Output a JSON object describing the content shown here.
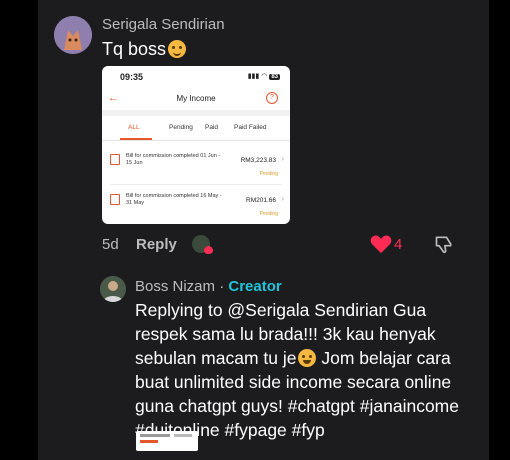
{
  "comment": {
    "username": "Serigala Sendirian",
    "text": "Tq boss",
    "emoji": "smiling-face-with-hearts-icon",
    "age": "5d",
    "reply_label": "Reply",
    "likes": "4"
  },
  "screenshot": {
    "time": "09:35",
    "battery": "83",
    "title": "My Income",
    "tabs": [
      "ALL",
      "Pending",
      "Paid",
      "Paid Failed"
    ],
    "rows": [
      {
        "desc": "Bill for commission completed 01 Jun - 15 Jun",
        "amount": "RM3,223.83",
        "status": "Pending"
      },
      {
        "desc": "Bill for commission completed 16 May - 31 May",
        "amount": "RM201.66",
        "status": "Pending"
      }
    ]
  },
  "reply": {
    "username": "Boss Nizam",
    "separator": " · ",
    "badge": "Creator",
    "text_part1": "Replying to @Serigala Sendirian Gua respek sama lu brada!!! 3k kau henyak sebulan macam tu je",
    "text_part2": " Jom belajar cara buat unlimited side income secara online guna chatgpt guys! #chatgpt #janaincome #duitonline #fypage #fyp",
    "emoji": "face-with-tears-of-joy-icon"
  },
  "colors": {
    "accent": "#e2582c",
    "like": "#fe2c55",
    "creator": "#20c4d8",
    "pending": "#d69b2a"
  }
}
